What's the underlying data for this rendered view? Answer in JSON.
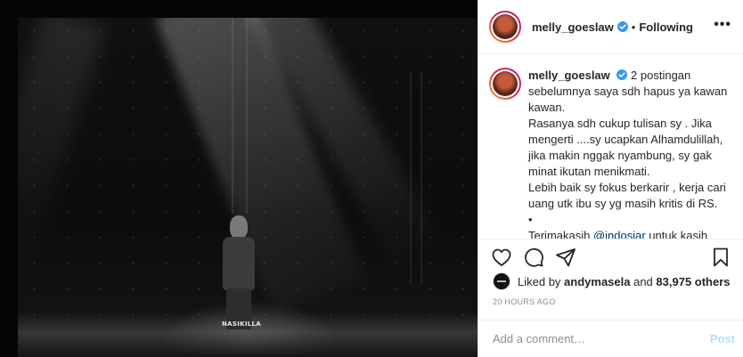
{
  "photo": {
    "watermark": "NASIKILLA"
  },
  "header": {
    "username": "melly_goeslaw",
    "separator": "•",
    "follow_status": "Following",
    "more_icon": "more-horizontal-icon"
  },
  "caption": {
    "username": "melly_goeslaw",
    "lines": [
      "2 postingan sebelumnya saya sdh hapus ya kawan kawan.",
      "Rasanya sdh cukup tulisan sy . Jika mengerti ....sy ucapkan Alhamdulillah, jika makin nggak nyambung, sy gak minat ikutan menikmati.",
      "Lebih baik sy fokus berkarir , kerja cari uang utk ibu sy yg masih kritis di RS.",
      "•"
    ],
    "last_prefix": "Terimakasih ",
    "last_mention": "@indosiar",
    "last_suffix": " untuk kasih"
  },
  "actions": {
    "icons": [
      "heart-icon",
      "comment-icon",
      "share-icon",
      "bookmark-icon"
    ]
  },
  "likes": {
    "prefix": "Liked by ",
    "user": "andymasela",
    "middle": " and ",
    "count": "83,975 others"
  },
  "timestamp": "20 HOURS AGO",
  "comment": {
    "placeholder": "Add a comment…",
    "post_label": "Post"
  },
  "colors": {
    "verified": "#3897f0",
    "link": "#00376b",
    "post_disabled": "#b2dffc",
    "muted": "#8e8e8e"
  }
}
